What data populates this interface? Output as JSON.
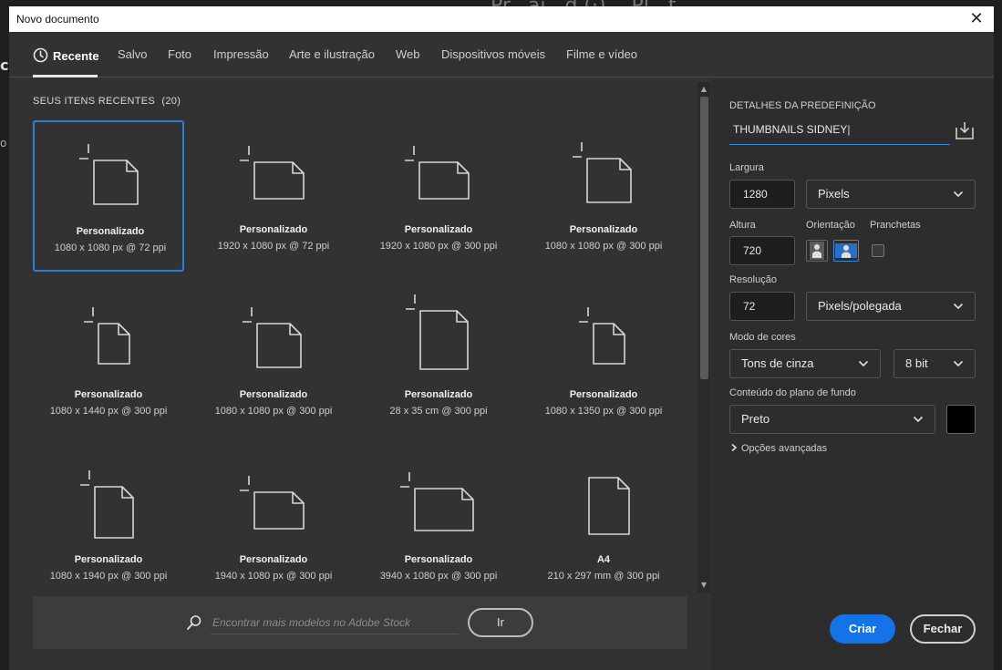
{
  "background_app": {
    "frag_left": "c",
    "frag_left2": "o",
    "frag_top": "Pr...ai...d (·)... Pl...t..."
  },
  "window": {
    "title": "Novo documento",
    "close_glyph": "✕"
  },
  "tabs": [
    {
      "label": "Recente",
      "icon": "clock-icon",
      "active": true
    },
    {
      "label": "Salvo"
    },
    {
      "label": "Foto"
    },
    {
      "label": "Impressão"
    },
    {
      "label": "Arte e ilustração"
    },
    {
      "label": "Web"
    },
    {
      "label": "Dispositivos móveis"
    },
    {
      "label": "Filme e vídeo"
    }
  ],
  "recent": {
    "title": "SEUS ITENS RECENTES",
    "count": "(20)",
    "items": [
      {
        "name": "Personalizado",
        "desc": "1080 x 1080 px @ 72 ppi",
        "selected": true,
        "shape": "square"
      },
      {
        "name": "Personalizado",
        "desc": "1920 x 1080 px @ 72 ppi",
        "shape": "landscape"
      },
      {
        "name": "Personalizado",
        "desc": "1920 x 1080 px @ 300 ppi",
        "shape": "landscape"
      },
      {
        "name": "Personalizado",
        "desc": "1080 x 1080 px @ 300 ppi",
        "shape": "square"
      },
      {
        "name": "Personalizado",
        "desc": "1080 x 1440 px @ 300 ppi",
        "shape": "portrait"
      },
      {
        "name": "Personalizado",
        "desc": "1080 x 1080 px @ 300 ppi",
        "shape": "square"
      },
      {
        "name": "Personalizado",
        "desc": "28 x 35 cm @ 300 ppi",
        "shape": "portrait_big"
      },
      {
        "name": "Personalizado",
        "desc": "1080 x 1350 px @ 300 ppi",
        "shape": "portrait"
      },
      {
        "name": "Personalizado",
        "desc": "1080 x 1940 px @ 300 ppi",
        "shape": "tall"
      },
      {
        "name": "Personalizado",
        "desc": "1940 x 1080 px @ 300 ppi",
        "shape": "landscape"
      },
      {
        "name": "Personalizado",
        "desc": "3940 x 1080 px @ 300 ppi",
        "shape": "wide"
      },
      {
        "name": "A4",
        "desc": "210 x 297 mm @ 300 ppi",
        "shape": "a4"
      }
    ]
  },
  "search": {
    "placeholder": "Encontrar mais modelos no Adobe Stock",
    "go_label": "Ir",
    "icon": "search-icon"
  },
  "details": {
    "section_title": "DETALHES DA PREDEFINIÇÃO",
    "preset_name": "THUMBNAILS SIDNEY",
    "save_icon": "save-preset-icon",
    "width_label": "Largura",
    "width_value": "1280",
    "width_unit": "Pixels",
    "height_label": "Altura",
    "height_value": "720",
    "orientation_label": "Orientação",
    "orientation_selected": "landscape",
    "artboards_label": "Pranchetas",
    "artboards_checked": false,
    "resolution_label": "Resolução",
    "resolution_value": "72",
    "resolution_unit": "Pixels/polegada",
    "color_mode_label": "Modo de cores",
    "color_mode": "Tons de cinza",
    "bit_depth": "8 bit",
    "background_label": "Conteúdo do plano de fundo",
    "background_value": "Preto",
    "background_color": "#000000",
    "advanced_label": "Opções avançadas",
    "create_label": "Criar",
    "close_label": "Fechar",
    "accent_color": "#1473e6"
  }
}
